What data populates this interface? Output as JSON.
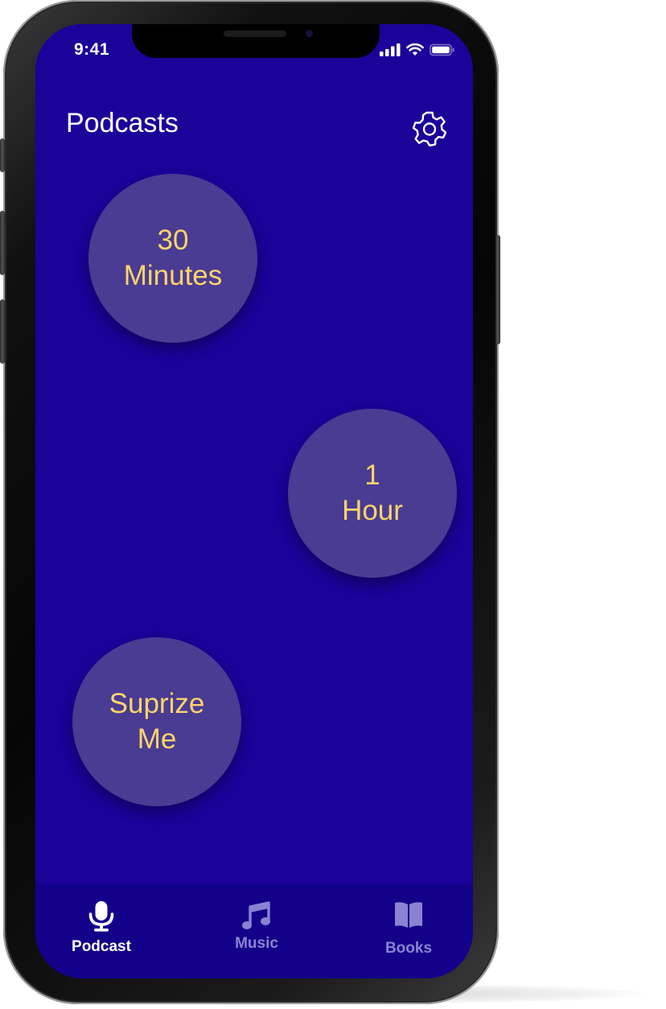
{
  "status_bar": {
    "time": "9:41"
  },
  "header": {
    "title": "Podcasts",
    "settings_icon": "gear-icon"
  },
  "options": [
    {
      "label_line1": "30",
      "label_line2": "Minutes"
    },
    {
      "label_line1": "1",
      "label_line2": "Hour"
    },
    {
      "label_line1": "Suprize",
      "label_line2": "Me"
    }
  ],
  "tabs": [
    {
      "label": "Podcast",
      "icon": "microphone-icon",
      "active": true
    },
    {
      "label": "Music",
      "icon": "music-note-icon",
      "active": false
    },
    {
      "label": "Books",
      "icon": "book-icon",
      "active": false
    }
  ],
  "colors": {
    "screen_background": "#1b0299",
    "tab_bar_background": "#13018a",
    "bubble_background": "#4a3b93",
    "bubble_text": "#fbd56a",
    "active_tab": "#ffffff",
    "inactive_tab": "#8c82d2"
  }
}
